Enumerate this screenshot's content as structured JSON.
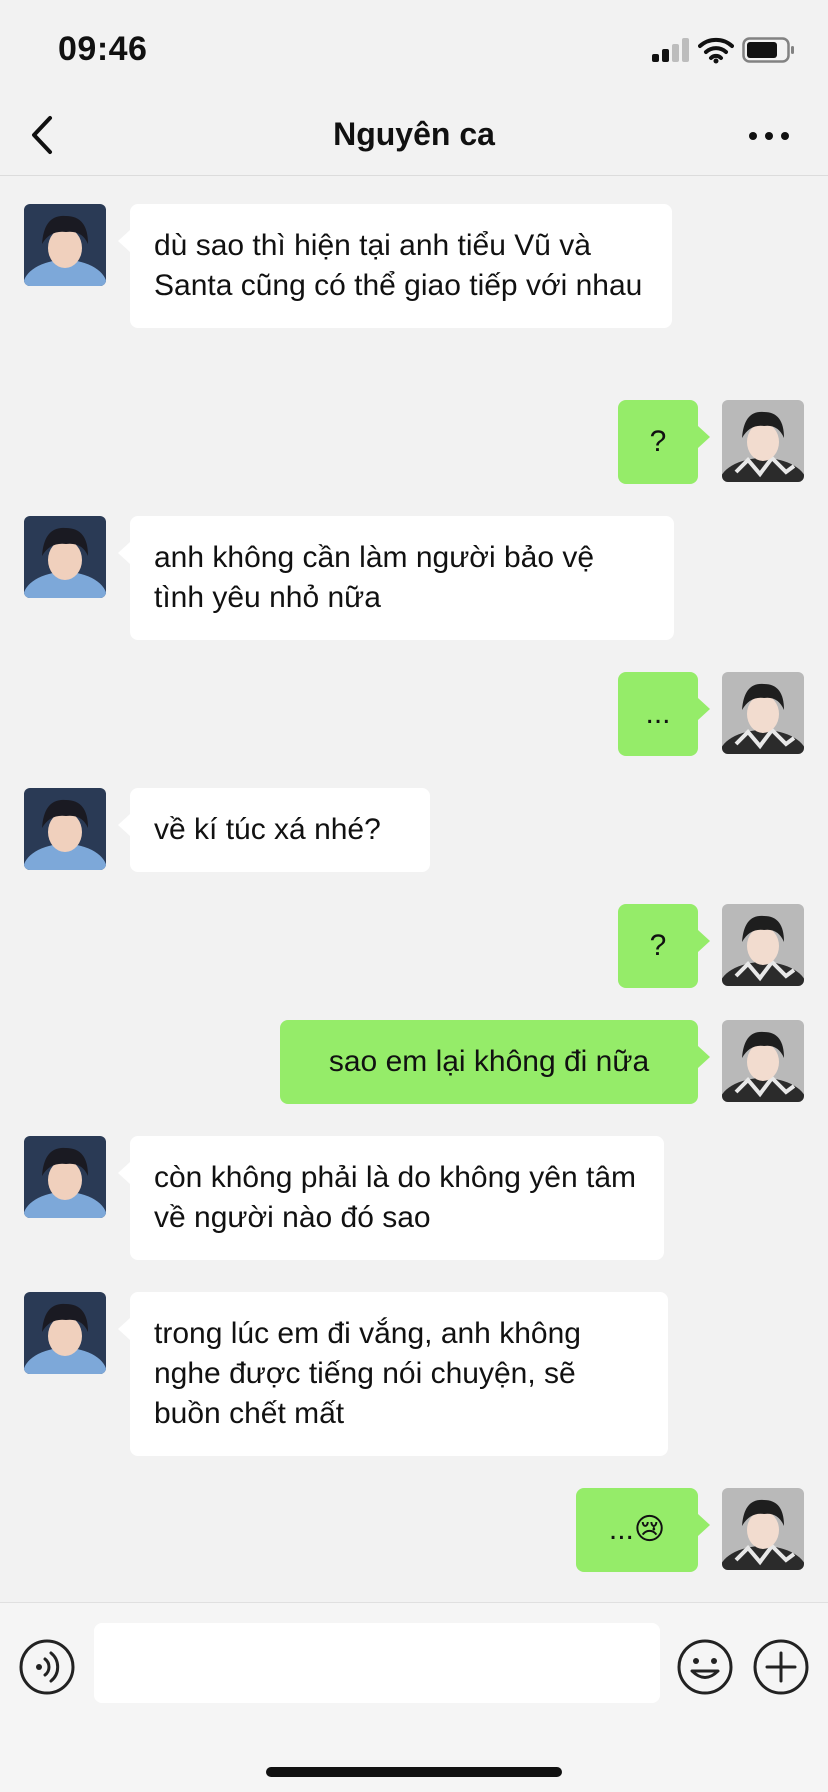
{
  "status_bar": {
    "time": "09:46"
  },
  "header": {
    "title": "Nguyên ca"
  },
  "messages": [
    {
      "side": "in",
      "text": "dù sao thì hiện tại anh tiểu Vũ và Santa cũng có thể giao tiếp với nhau"
    },
    {
      "side": "out",
      "text": "?"
    },
    {
      "side": "in",
      "text": "anh không cần làm người bảo vệ tình yêu nhỏ nữa"
    },
    {
      "side": "out",
      "text": "..."
    },
    {
      "side": "in",
      "text": "về kí túc xá nhé?"
    },
    {
      "side": "out",
      "text": "?"
    },
    {
      "side": "out",
      "text": "sao em lại không đi nữa"
    },
    {
      "side": "in",
      "text": "còn không phải là do không yên tâm về người nào đó sao"
    },
    {
      "side": "in",
      "text": "trong lúc em đi vắng, anh không nghe được tiếng nói chuyện, sẽ buồn chết mất"
    },
    {
      "side": "out",
      "text": "...😢"
    }
  ],
  "input": {
    "value": ""
  },
  "colors": {
    "outgoing_bubble": "#95ec69",
    "incoming_bubble": "#ffffff",
    "background": "#f2f2f2"
  }
}
